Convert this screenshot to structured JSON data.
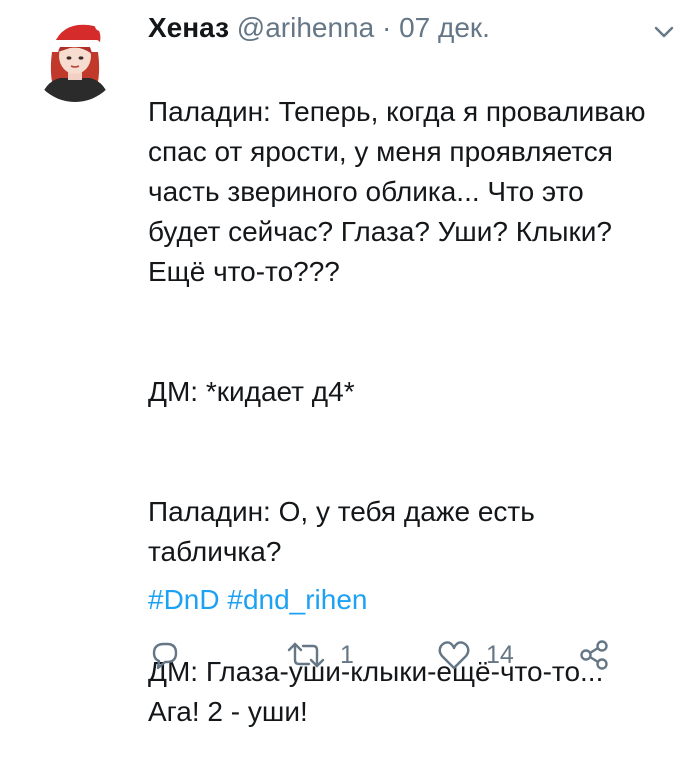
{
  "colors": {
    "text": "#14171a",
    "muted": "#657786",
    "link": "#1da1f2"
  },
  "tweet": {
    "author_name": "Хеназ",
    "author_handle": "@arihenna",
    "separator": "·",
    "date": "07 дек.",
    "paragraphs": [
      "Паладин: Теперь, когда я проваливаю\nспас от ярости, у меня проявляется\nчасть звериного облика... Что это\nбудет сейчас? Глаза? Уши? Клыки?\nЕщё что-то???",
      "ДМ: *кидает д4*",
      "Паладин: О, у тебя даже есть\nтабличка?",
      "ДМ: Глаза-уши-клыки-ещё-что-то...\nАга! 2 - уши!"
    ],
    "hashtags": [
      "#DnD",
      "#dnd_rihen"
    ],
    "actions": {
      "reply_icon": "reply-icon",
      "retweet_icon": "retweet-icon",
      "retweet_count": "1",
      "like_icon": "heart-icon",
      "like_count": "14",
      "share_icon": "share-icon"
    },
    "menu_icon": "chevron-down-icon",
    "avatar": "avatar"
  }
}
